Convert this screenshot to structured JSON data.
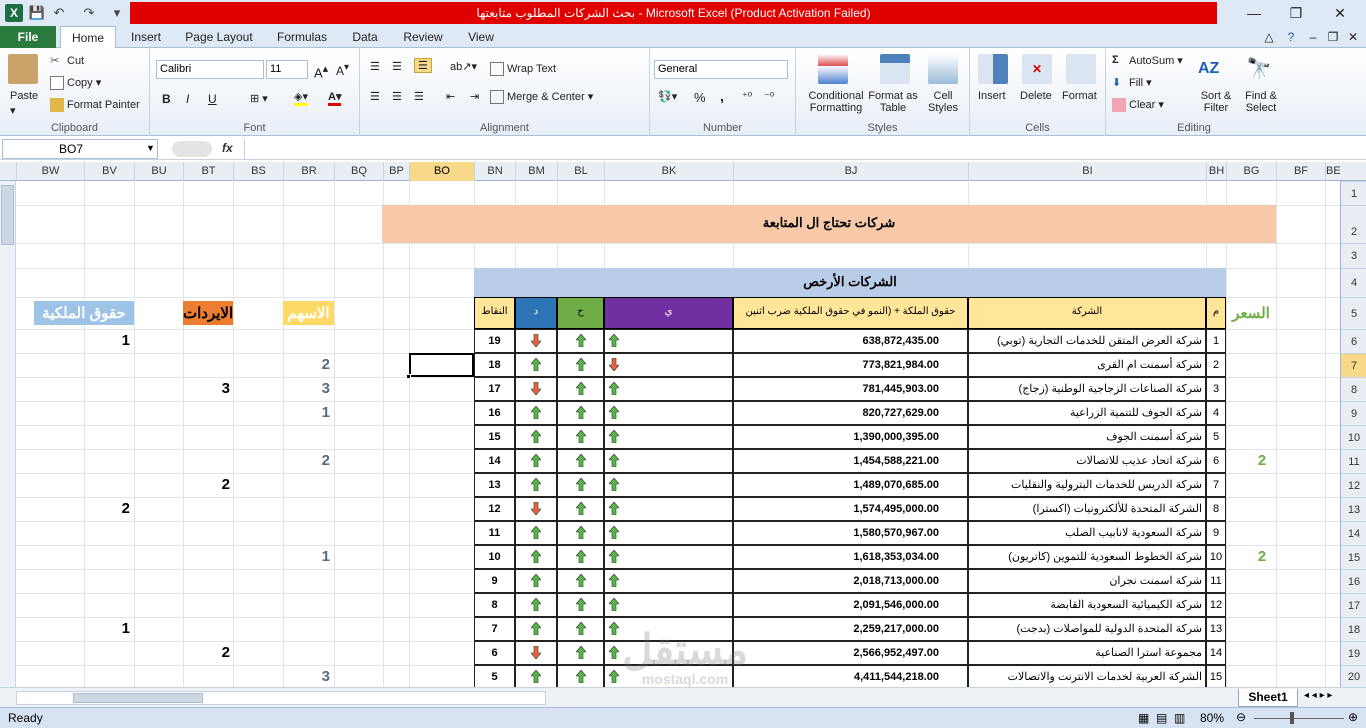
{
  "app": {
    "logo_letter": "X",
    "window_title": "بحث الشركات المطلوب متابعتها  -  Microsoft Excel (Product Activation Failed)"
  },
  "tabs": [
    "File",
    "Home",
    "Insert",
    "Page Layout",
    "Formulas",
    "Data",
    "Review",
    "View"
  ],
  "ribbon": {
    "clipboard": {
      "label": "Clipboard",
      "paste": "Paste",
      "cut": "Cut",
      "copy": "Copy",
      "format_painter": "Format Painter"
    },
    "font": {
      "label": "Font",
      "font_name": "Calibri",
      "font_size": "11",
      "bold": "B",
      "italic": "I",
      "underline": "U"
    },
    "alignment": {
      "label": "Alignment",
      "wrap_text": "Wrap Text",
      "merge_center": "Merge & Center"
    },
    "number": {
      "label": "Number",
      "format": "General",
      "percent": "%",
      "comma": ","
    },
    "styles": {
      "label": "Styles",
      "conditional_formatting": "Conditional Formatting",
      "format_as_table": "Format as Table",
      "cell_styles": "Cell Styles"
    },
    "cells": {
      "label": "Cells",
      "insert": "Insert",
      "delete": "Delete",
      "format": "Format"
    },
    "editing": {
      "label": "Editing",
      "autosum": "AutoSum",
      "fill": "Fill",
      "clear": "Clear",
      "sort_filter": "Sort & Filter",
      "find_select": "Find & Select"
    }
  },
  "formula_bar": {
    "name_box": "BO7",
    "fx": "fx",
    "value": ""
  },
  "columns": [
    "BW",
    "BV",
    "BU",
    "BT",
    "BS",
    "BR",
    "BQ",
    "BP",
    "BO",
    "BN",
    "BM",
    "BL",
    "BK",
    "BJ",
    "BI",
    "BH",
    "BG",
    "BF",
    "BE"
  ],
  "selected_column": "BO",
  "rows": [
    "1",
    "2",
    "3",
    "4",
    "5",
    "6",
    "7",
    "8",
    "9",
    "10",
    "11",
    "12",
    "13",
    "14",
    "15",
    "16",
    "17",
    "18",
    "19",
    "20"
  ],
  "selected_row": "7",
  "sheet": {
    "banner_title": "شركات تحتاج ال المتابعة",
    "table_title": "الشركات الأرخص",
    "headers": {
      "index": "م",
      "company": "الشركة",
      "equity": "حقوق الملكة + (النمو في حقوق الملكية  ضرب اثنين",
      "y": "ي",
      "h": "ح",
      "d": "د",
      "points": "النقاط"
    },
    "side_headers": {
      "price": "السعر",
      "shares": "الاسهم",
      "revenues": "الايردات",
      "equity": "حقوق الملكية"
    },
    "table_rows": [
      {
        "index": "1",
        "company": "شركة العرض المتقن للخدمات التجارية (توبي)",
        "equity": "638,872,435.00",
        "y": "up",
        "h": "up",
        "d": "down",
        "points": "19"
      },
      {
        "index": "2",
        "company": "شركة أسمنت ام القرى",
        "equity": "773,821,984.00",
        "y": "down",
        "h": "up",
        "d": "up",
        "points": "18"
      },
      {
        "index": "3",
        "company": "شركة الصناعات الزجاجية الوطنية (زجاج)",
        "equity": "781,445,903.00",
        "y": "up",
        "h": "up",
        "d": "down",
        "points": "17"
      },
      {
        "index": "4",
        "company": "شركة الجوف للتنمية الزراعية",
        "equity": "820,727,629.00",
        "y": "up",
        "h": "up",
        "d": "up",
        "points": "16"
      },
      {
        "index": "5",
        "company": "شركة أسمنت الجوف",
        "equity": "1,390,000,395.00",
        "y": "up",
        "h": "up",
        "d": "up",
        "points": "15"
      },
      {
        "index": "6",
        "company": "شركة اتحاد عذيب للاتصالات",
        "equity": "1,454,588,221.00",
        "y": "up",
        "h": "up",
        "d": "up",
        "points": "14"
      },
      {
        "index": "7",
        "company": "شركة الدريس للخدمات البترولية والنقليات",
        "equity": "1,489,070,685.00",
        "y": "up",
        "h": "up",
        "d": "up",
        "points": "13"
      },
      {
        "index": "8",
        "company": "الشركة المتحدة للألكترونيات (اكسترا)",
        "equity": "1,574,495,000.00",
        "y": "up",
        "h": "up",
        "d": "down",
        "points": "12"
      },
      {
        "index": "9",
        "company": "شركة السعودية لانابيب الصلب",
        "equity": "1,580,570,967.00",
        "y": "up",
        "h": "up",
        "d": "up",
        "points": "11"
      },
      {
        "index": "10",
        "company": "شركة الخطوط السعودية للتموين (كاتريون)",
        "equity": "1,618,353,034.00",
        "y": "up",
        "h": "up",
        "d": "up",
        "points": "10"
      },
      {
        "index": "11",
        "company": "شركة اسمنت نجران",
        "equity": "2,018,713,000.00",
        "y": "up",
        "h": "up",
        "d": "up",
        "points": "9"
      },
      {
        "index": "12",
        "company": "شركة الكيميائية السعودية القابضة",
        "equity": "2,091,546,000.00",
        "y": "up",
        "h": "up",
        "d": "up",
        "points": "8"
      },
      {
        "index": "13",
        "company": "شركة المتحدة الدولية للمواصلات (بدجت)",
        "equity": "2,259,217,000.00",
        "y": "up",
        "h": "up",
        "d": "up",
        "points": "7"
      },
      {
        "index": "14",
        "company": "مجموعة استرا الصناعية",
        "equity": "2,566,952,497.00",
        "y": "up",
        "h": "up",
        "d": "down",
        "points": "6"
      },
      {
        "index": "15",
        "company": "الشركة العربية لخدمات الانترنت والاتصالات (سلوشنز)",
        "equity": "4,411,544,218.00",
        "y": "up",
        "h": "up",
        "d": "up",
        "points": "5"
      }
    ],
    "side_values": [
      {
        "price": "",
        "shares": "",
        "revenues": "",
        "equity": "1"
      },
      {
        "price": "",
        "shares": "2",
        "revenues": "",
        "equity": ""
      },
      {
        "price": "",
        "shares": "3",
        "revenues": "3",
        "equity": ""
      },
      {
        "price": "",
        "shares": "1",
        "revenues": "",
        "equity": ""
      },
      {
        "price": "",
        "shares": "",
        "revenues": "",
        "equity": ""
      },
      {
        "price": "2",
        "shares": "2",
        "revenues": "",
        "equity": ""
      },
      {
        "price": "",
        "shares": "",
        "revenues": "2",
        "equity": ""
      },
      {
        "price": "",
        "shares": "",
        "revenues": "",
        "equity": "2"
      },
      {
        "price": "",
        "shares": "",
        "revenues": "",
        "equity": ""
      },
      {
        "price": "2",
        "shares": "1",
        "revenues": "",
        "equity": ""
      },
      {
        "price": "",
        "shares": "",
        "revenues": "",
        "equity": ""
      },
      {
        "price": "",
        "shares": "",
        "revenues": "",
        "equity": ""
      },
      {
        "price": "",
        "shares": "",
        "revenues": "",
        "equity": "1"
      },
      {
        "price": "",
        "shares": "",
        "revenues": "2",
        "equity": ""
      },
      {
        "price": "",
        "shares": "3",
        "revenues": "",
        "equity": ""
      }
    ]
  },
  "colors": {
    "banner": "#f7c9a9",
    "table_title": "#b9cce8",
    "hdr_yellow": "#ffe699",
    "hdr_green": "#70ad47",
    "hdr_purple": "#7030a0",
    "hdr_blue": "#2e75b6",
    "shares_bg": "#ffd966",
    "revenues_bg": "#ed7d31",
    "equity_bg": "#9dc3e6",
    "price_color": "#70ad47",
    "up_arrow": "#57b847",
    "down_arrow": "#e8643c"
  },
  "status": {
    "ready": "Ready",
    "zoom": "80%",
    "sheet_tab": "Sheet1"
  },
  "watermark": {
    "text": "مستقل",
    "sub": "mostaql.com"
  }
}
